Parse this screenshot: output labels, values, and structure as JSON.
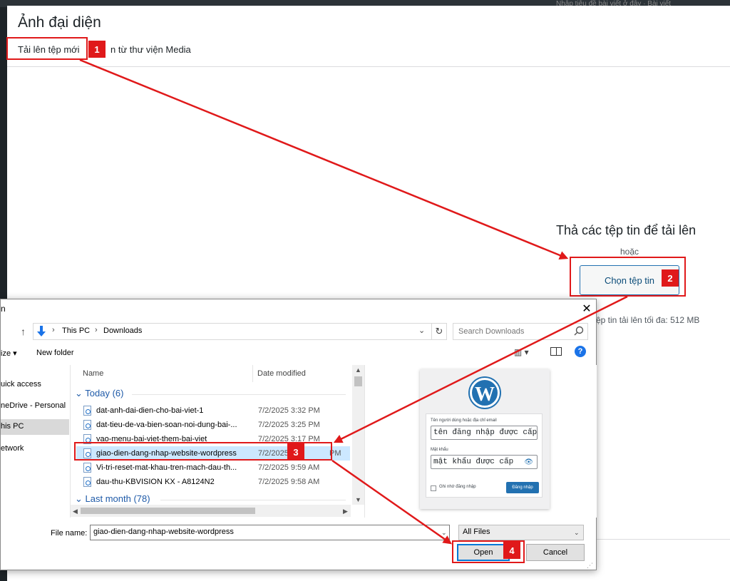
{
  "background": {
    "top_right_text": "Nhập tiêu đề bài viết ở đây · Bài viết"
  },
  "wp_modal": {
    "title": "Ảnh đại diện",
    "tabs": [
      {
        "label": "Tải lên tệp mới",
        "active": true
      },
      {
        "label": "n từ thư viện Media",
        "active": false
      }
    ],
    "drop_title": "Thả các tệp tin để tải lên",
    "or_text": "hoặc",
    "select_button": "Chọn tệp tin",
    "max_size": "ệp tin tải lên tối đa: 512 MB"
  },
  "annotations": {
    "badge1": "1",
    "badge2": "2",
    "badge3": "3",
    "badge4": "4",
    "color": "#e0191a"
  },
  "dialog": {
    "title": "n",
    "close": "✕",
    "up_arrow": "↑",
    "address": {
      "crumbs": [
        "This PC",
        "Downloads"
      ],
      "separator": "›",
      "dropdown": "⌄",
      "refresh": "↻"
    },
    "search_placeholder": "Search Downloads",
    "toolbar": {
      "organize": "ize ▾",
      "new_folder": "New folder",
      "view": "▥ ▾",
      "help": "?"
    },
    "nav_items": [
      {
        "label": "uick access",
        "selected": false
      },
      {
        "label": "neDrive - Personal",
        "selected": false
      },
      {
        "label": "his PC",
        "selected": true
      },
      {
        "label": "etwork",
        "selected": false
      }
    ],
    "columns": {
      "name": "Name",
      "date": "Date modified"
    },
    "groups": {
      "today": "Today (6)",
      "today_chev": "⌄",
      "last_month": "Last month (78)",
      "last_month_chev": "⌄"
    },
    "files": [
      {
        "name": "dat-anh-dai-dien-cho-bai-viet-1",
        "date": "7/2/2025 3:32 PM",
        "selected": false
      },
      {
        "name": "dat-tieu-de-va-bien-soan-noi-dung-bai-...",
        "date": "7/2/2025 3:25 PM",
        "selected": false
      },
      {
        "name": "vao-menu-bai-viet-them-bai-viet",
        "date": "7/2/2025 3:17 PM",
        "selected": false
      },
      {
        "name": "giao-dien-dang-nhap-website-wordpress",
        "date": "7/2/2025",
        "date_tail": "PM",
        "selected": true
      },
      {
        "name": "Vi-tri-reset-mat-khau-tren-mach-dau-th...",
        "date": "7/2/2025 9:59 AM",
        "selected": false
      },
      {
        "name": "dau-thu-KBVISION KX - A8124N2",
        "date": "7/2/2025 9:58 AM",
        "selected": false
      }
    ],
    "scroll": {
      "up": "▲",
      "down": "▼",
      "left": "◀",
      "right": "▶"
    },
    "preview": {
      "logo": "W",
      "username_label": "Tên người dùng hoặc địa chỉ email",
      "username_value": "tên đăng nhập được cấp",
      "password_label": "Mật khẩu",
      "password_value": "mật khẩu được cấp",
      "eye": "👁",
      "remember": "Ghi nhớ đăng nhập",
      "login_button": "Đăng nhập"
    },
    "file_name_label": "File name:",
    "file_name_value": "giao-dien-dang-nhap-website-wordpress",
    "chev": "⌄",
    "file_type": "All Files",
    "open_button": "Open",
    "cancel_button": "Cancel",
    "grip": "⋰"
  }
}
